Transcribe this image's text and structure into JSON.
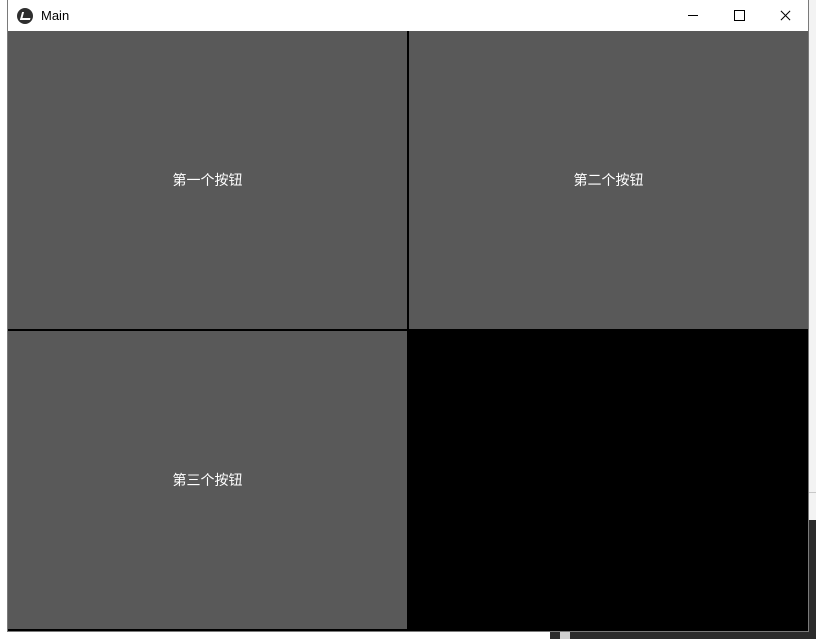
{
  "window": {
    "title": "Main"
  },
  "buttons": {
    "first": "第一个按钮",
    "second": "第二个按钮",
    "third": "第三个按钮"
  },
  "colors": {
    "button_bg": "#595959",
    "content_bg": "#000000",
    "titlebar_bg": "#ffffff",
    "button_text": "#ffffff"
  },
  "icons": {
    "app": "kivy-logo-icon",
    "minimize": "minimize-icon",
    "maximize": "maximize-icon",
    "close": "close-icon"
  }
}
